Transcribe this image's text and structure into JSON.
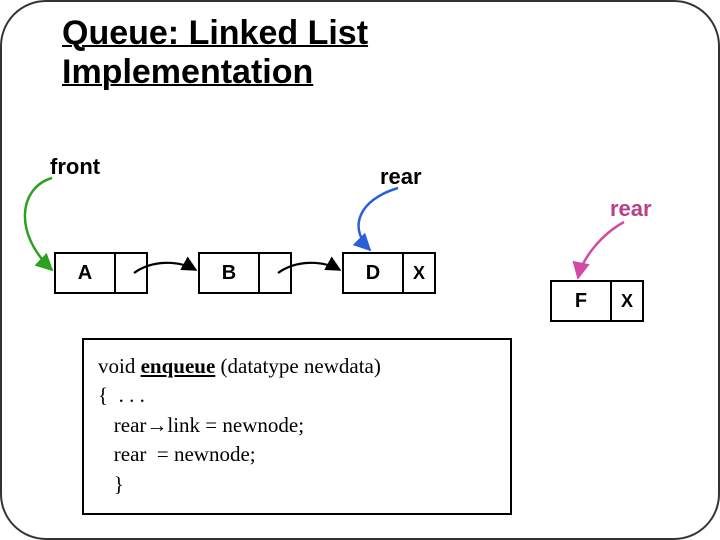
{
  "title_line1": "Queue: Linked List",
  "title_line2": "Implementation",
  "labels": {
    "front": "front",
    "rear1": "rear",
    "rear2": "rear"
  },
  "nodes": {
    "A": {
      "data": "A",
      "ptr": ""
    },
    "B": {
      "data": "B",
      "ptr": ""
    },
    "D": {
      "data": "D",
      "ptr": "X"
    },
    "F": {
      "data": "F",
      "ptr": "X"
    }
  },
  "code": {
    "sig_prefix": "void ",
    "sig_fn": "enqueue",
    "sig_suffix": " (datatype newdata)",
    "l2": "{  . . .",
    "l3": "   rear→link = newnode;",
    "l4": "   rear  = newnode;",
    "l5": "   }"
  },
  "chart_data": {
    "type": "diagram",
    "description": "Singly linked list queue with front pointing to node A and rear moving from node D to new node F after enqueue.",
    "nodes": [
      "A",
      "B",
      "D",
      "F"
    ],
    "links": [
      [
        "A",
        "B"
      ],
      [
        "B",
        "D"
      ]
    ],
    "front": "A",
    "rear_before": "D",
    "rear_after": "F",
    "new_node": "F",
    "operation": "enqueue(newdata)",
    "pseudocode": [
      "rear->link = newnode;",
      "rear = newnode;"
    ]
  }
}
